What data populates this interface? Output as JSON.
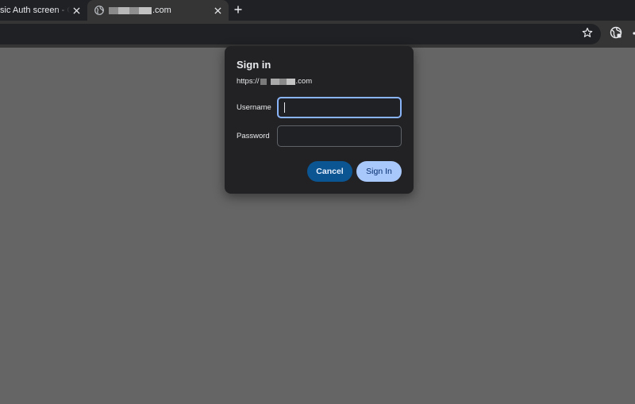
{
  "browser": {
    "tabs": [
      {
        "title": "sic Auth screen - Cle",
        "active": false
      },
      {
        "title": ".com",
        "active": true
      }
    ],
    "new_tab_label": "+",
    "close_glyph": "✕"
  },
  "dialog": {
    "title": "Sign in",
    "url_prefix": "https://",
    "url_suffix": ".com",
    "username_label": "Username",
    "password_label": "Password",
    "username_value": "",
    "password_value": "",
    "cancel_label": "Cancel",
    "signin_label": "Sign In"
  },
  "colors": {
    "accent": "#8ab4f8",
    "primary_button": "#a8c7fa",
    "secondary_button": "#0b5592",
    "page_background": "#656565"
  },
  "icons": [
    "globe-icon",
    "close-icon",
    "plus-icon",
    "star-icon",
    "extension-icon"
  ]
}
